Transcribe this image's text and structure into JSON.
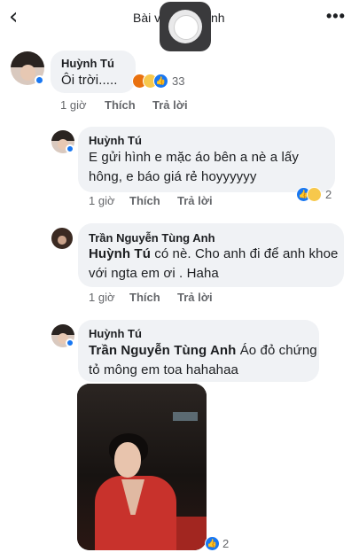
{
  "header": {
    "back_icon": "back-arrow-icon",
    "title_start": "Bài v",
    "title_end": "nh",
    "more_icon": "more-options-icon",
    "more_label": "•••"
  },
  "comments": [
    {
      "author": "Huỳnh Tú",
      "text": "Ôi trời.....",
      "time": "1 giờ",
      "like": "Thích",
      "reply": "Trả lời",
      "reactions": {
        "icons": [
          "angry-reaction-icon",
          "haha-reaction-icon",
          "like-reaction-icon"
        ],
        "count": "33"
      }
    },
    {
      "author": "Huỳnh Tú",
      "text": "E gửi hình e mặc áo bên a nè a lấy hông, e báo giá rẻ hoyyyyyy",
      "time": "1 giờ",
      "like": "Thích",
      "reply": "Trả lời",
      "reactions": {
        "icons": [
          "like-reaction-icon",
          "haha-reaction-icon"
        ],
        "count": "2"
      }
    },
    {
      "author": "Trần Nguyễn Tùng Anh",
      "mention": "Huỳnh Tú",
      "text": " có nè. Cho anh đi để anh khoe với ngta em ơi . Haha",
      "time": "1 giờ",
      "like": "Thích",
      "reply": "Trả lời"
    },
    {
      "author": "Huỳnh Tú",
      "mention": "Trần Nguyễn Tùng Anh",
      "text": "  Áo đỏ chứng tỏ mông em toa hahahaa",
      "photo": "woman-in-red-jacket-photo",
      "reactions": {
        "icons": [
          "like-reaction-icon"
        ],
        "count": "2"
      }
    }
  ],
  "colors": {
    "bubble": "#f0f2f5",
    "link_blue": "#1877f2",
    "meta_gray": "#65676b"
  }
}
